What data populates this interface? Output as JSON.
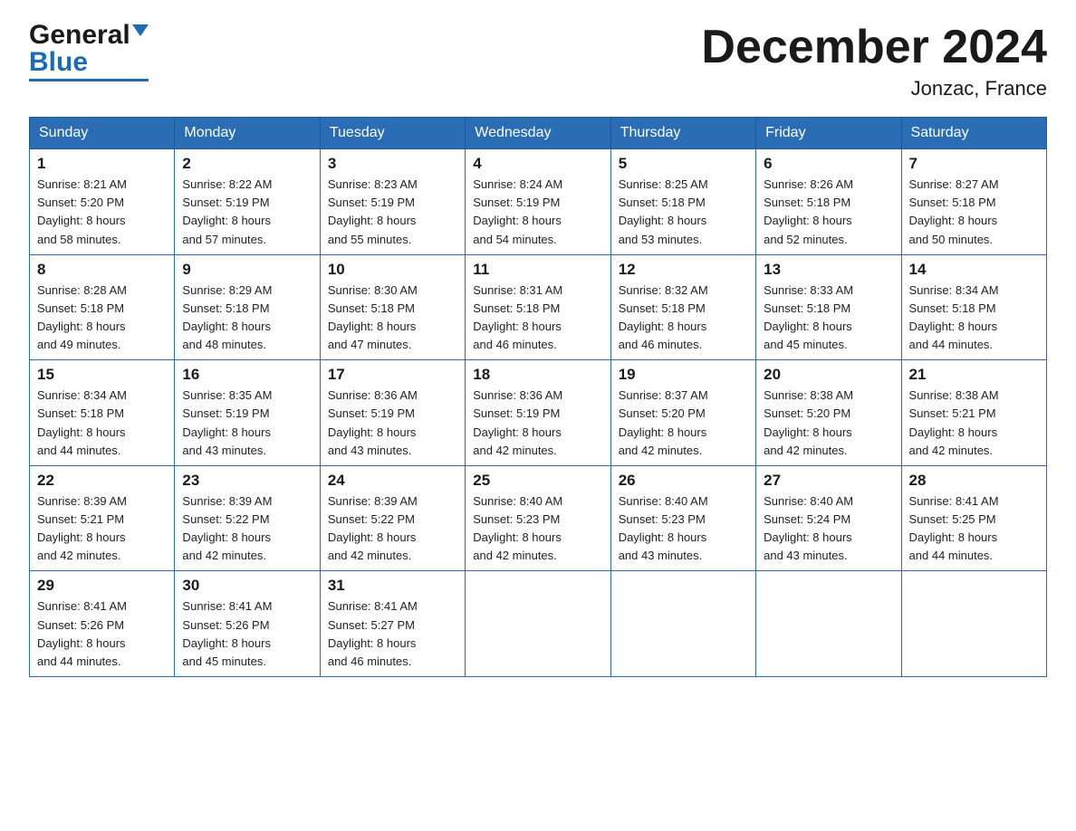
{
  "header": {
    "logo_general": "General",
    "logo_blue": "Blue",
    "month_title": "December 2024",
    "location": "Jonzac, France"
  },
  "days_of_week": [
    "Sunday",
    "Monday",
    "Tuesday",
    "Wednesday",
    "Thursday",
    "Friday",
    "Saturday"
  ],
  "weeks": [
    [
      {
        "day": "1",
        "sunrise": "8:21 AM",
        "sunset": "5:20 PM",
        "daylight": "8 hours and 58 minutes."
      },
      {
        "day": "2",
        "sunrise": "8:22 AM",
        "sunset": "5:19 PM",
        "daylight": "8 hours and 57 minutes."
      },
      {
        "day": "3",
        "sunrise": "8:23 AM",
        "sunset": "5:19 PM",
        "daylight": "8 hours and 55 minutes."
      },
      {
        "day": "4",
        "sunrise": "8:24 AM",
        "sunset": "5:19 PM",
        "daylight": "8 hours and 54 minutes."
      },
      {
        "day": "5",
        "sunrise": "8:25 AM",
        "sunset": "5:18 PM",
        "daylight": "8 hours and 53 minutes."
      },
      {
        "day": "6",
        "sunrise": "8:26 AM",
        "sunset": "5:18 PM",
        "daylight": "8 hours and 52 minutes."
      },
      {
        "day": "7",
        "sunrise": "8:27 AM",
        "sunset": "5:18 PM",
        "daylight": "8 hours and 50 minutes."
      }
    ],
    [
      {
        "day": "8",
        "sunrise": "8:28 AM",
        "sunset": "5:18 PM",
        "daylight": "8 hours and 49 minutes."
      },
      {
        "day": "9",
        "sunrise": "8:29 AM",
        "sunset": "5:18 PM",
        "daylight": "8 hours and 48 minutes."
      },
      {
        "day": "10",
        "sunrise": "8:30 AM",
        "sunset": "5:18 PM",
        "daylight": "8 hours and 47 minutes."
      },
      {
        "day": "11",
        "sunrise": "8:31 AM",
        "sunset": "5:18 PM",
        "daylight": "8 hours and 46 minutes."
      },
      {
        "day": "12",
        "sunrise": "8:32 AM",
        "sunset": "5:18 PM",
        "daylight": "8 hours and 46 minutes."
      },
      {
        "day": "13",
        "sunrise": "8:33 AM",
        "sunset": "5:18 PM",
        "daylight": "8 hours and 45 minutes."
      },
      {
        "day": "14",
        "sunrise": "8:34 AM",
        "sunset": "5:18 PM",
        "daylight": "8 hours and 44 minutes."
      }
    ],
    [
      {
        "day": "15",
        "sunrise": "8:34 AM",
        "sunset": "5:18 PM",
        "daylight": "8 hours and 44 minutes."
      },
      {
        "day": "16",
        "sunrise": "8:35 AM",
        "sunset": "5:19 PM",
        "daylight": "8 hours and 43 minutes."
      },
      {
        "day": "17",
        "sunrise": "8:36 AM",
        "sunset": "5:19 PM",
        "daylight": "8 hours and 43 minutes."
      },
      {
        "day": "18",
        "sunrise": "8:36 AM",
        "sunset": "5:19 PM",
        "daylight": "8 hours and 42 minutes."
      },
      {
        "day": "19",
        "sunrise": "8:37 AM",
        "sunset": "5:20 PM",
        "daylight": "8 hours and 42 minutes."
      },
      {
        "day": "20",
        "sunrise": "8:38 AM",
        "sunset": "5:20 PM",
        "daylight": "8 hours and 42 minutes."
      },
      {
        "day": "21",
        "sunrise": "8:38 AM",
        "sunset": "5:21 PM",
        "daylight": "8 hours and 42 minutes."
      }
    ],
    [
      {
        "day": "22",
        "sunrise": "8:39 AM",
        "sunset": "5:21 PM",
        "daylight": "8 hours and 42 minutes."
      },
      {
        "day": "23",
        "sunrise": "8:39 AM",
        "sunset": "5:22 PM",
        "daylight": "8 hours and 42 minutes."
      },
      {
        "day": "24",
        "sunrise": "8:39 AM",
        "sunset": "5:22 PM",
        "daylight": "8 hours and 42 minutes."
      },
      {
        "day": "25",
        "sunrise": "8:40 AM",
        "sunset": "5:23 PM",
        "daylight": "8 hours and 42 minutes."
      },
      {
        "day": "26",
        "sunrise": "8:40 AM",
        "sunset": "5:23 PM",
        "daylight": "8 hours and 43 minutes."
      },
      {
        "day": "27",
        "sunrise": "8:40 AM",
        "sunset": "5:24 PM",
        "daylight": "8 hours and 43 minutes."
      },
      {
        "day": "28",
        "sunrise": "8:41 AM",
        "sunset": "5:25 PM",
        "daylight": "8 hours and 44 minutes."
      }
    ],
    [
      {
        "day": "29",
        "sunrise": "8:41 AM",
        "sunset": "5:26 PM",
        "daylight": "8 hours and 44 minutes."
      },
      {
        "day": "30",
        "sunrise": "8:41 AM",
        "sunset": "5:26 PM",
        "daylight": "8 hours and 45 minutes."
      },
      {
        "day": "31",
        "sunrise": "8:41 AM",
        "sunset": "5:27 PM",
        "daylight": "8 hours and 46 minutes."
      },
      null,
      null,
      null,
      null
    ]
  ],
  "labels": {
    "sunrise": "Sunrise:",
    "sunset": "Sunset:",
    "daylight": "Daylight:"
  }
}
